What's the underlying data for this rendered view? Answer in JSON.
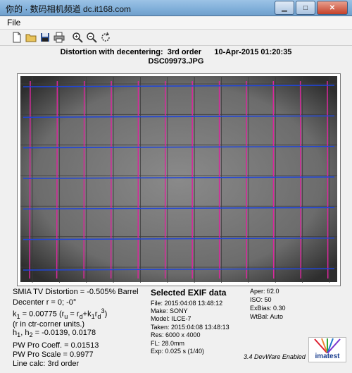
{
  "window": {
    "title": "你的 · 数码相机频道 dc.it168.com",
    "min_glyph": "▁",
    "max_glyph": "□",
    "close_glyph": "✕"
  },
  "menu": {
    "file": "File"
  },
  "toolbar": {
    "icons": [
      "new-file-icon",
      "open-folder-icon",
      "save-icon",
      "print-icon",
      "zoom-in-icon",
      "zoom-out-icon",
      "rotate-icon"
    ]
  },
  "figure": {
    "title": "Distortion with decentering:  3rd order      10-Apr-2015 01:20:35",
    "filename": "DSC09973.JPG",
    "grid": {
      "vertical_lines": 12,
      "horizontal_lines": 7
    },
    "colors": {
      "vertical": "#d8289c",
      "horizontal": "#1f45d9",
      "background": "#6d6d6d"
    }
  },
  "results": {
    "tv_distortion": "SMIA TV Distortion = -0.505% Barrel",
    "decenter": "Decenter r = 0;  -0°",
    "k1": "k",
    "k1_sub": "1",
    "k1_val": " = 0.00775  (r",
    "k1_sub2": "u",
    "k1_rest": " = r",
    "k1_sub3": "d",
    "k1_rest2": "+k",
    "k1_sub4": "1",
    "k1_rest3": "r",
    "k1_sub5": "d",
    "k1_sup": "3",
    "k1_close": ")",
    "units": "(r in ctr-corner units.)",
    "h_label": "h",
    "h_sub1": "1",
    "h_comma": ", h",
    "h_sub2": "2",
    "h_val": " = -0.0139, 0.0178",
    "pw_coeff": "PW Pro Coeff. = 0.01513",
    "pw_scale": "PW Pro Scale = 0.9977",
    "line_calc": "Line calc: 3rd order"
  },
  "exif": {
    "heading": "Selected EXIF data",
    "file": "File:  2015:04:08 13:48:12",
    "make": "Make:  SONY",
    "model": "Model: ILCE-7",
    "taken": "Taken: 2015:04:08 13:48:13",
    "res": "Res:    6000 x 4000",
    "fl": "FL:  28.0mm",
    "exp": "Exp:   0.025 s  (1/40)",
    "aper": "Aper:  f/2.0",
    "iso": "ISO:   50",
    "exbias": "ExBias: 0.30",
    "wtbal": "WtBal: Auto"
  },
  "footer": {
    "version": "3.4  DevWare Enabled",
    "logo": "imatest"
  }
}
